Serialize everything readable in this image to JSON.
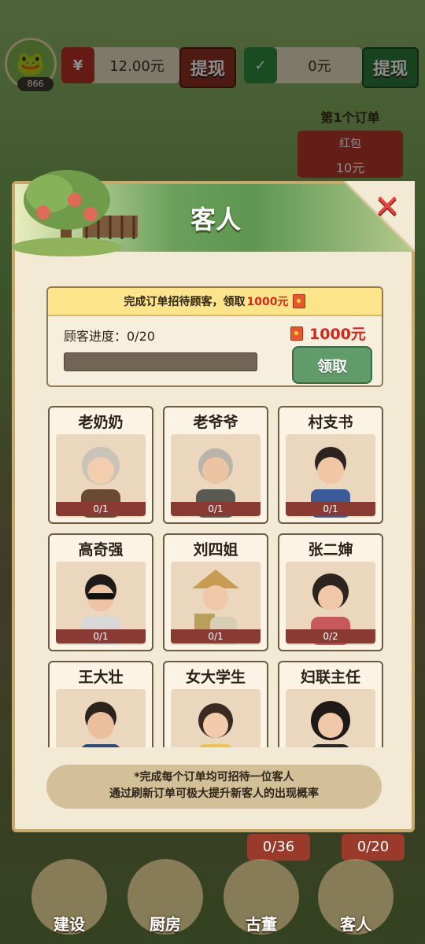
{
  "topbar": {
    "level": "866",
    "cash_red": "12.00元",
    "withdraw_label": "提现",
    "cash_green": "0元",
    "withdraw_label_2": "提现"
  },
  "order": {
    "title": "第1个订单",
    "reward_label": "红包",
    "reward_amount": "10元"
  },
  "modal": {
    "title": "客人",
    "close": "✕",
    "progress": {
      "banner_prefix": "完成订单招待顾客，领取",
      "banner_amount": "1000元",
      "label": "顾客进度：0/20",
      "current": 0,
      "total": 20,
      "reward": "1000元",
      "claim_label": "领取"
    },
    "guests": [
      {
        "name": "老奶奶",
        "count": "0/1"
      },
      {
        "name": "老爷爷",
        "count": "0/1"
      },
      {
        "name": "村支书",
        "count": "0/1"
      },
      {
        "name": "高奇强",
        "count": "0/1"
      },
      {
        "name": "刘四姐",
        "count": "0/1"
      },
      {
        "name": "张二婶",
        "count": "0/2"
      },
      {
        "name": "王大壮",
        "count": ""
      },
      {
        "name": "女大学生",
        "count": ""
      },
      {
        "name": "妇联主任",
        "count": ""
      }
    ],
    "note_line1": "*完成每个订单均可招待一位客人",
    "note_line2": "通过刷新订单可极大提升新客人的出现概率"
  },
  "nav": {
    "build": "建设",
    "kitchen": "厨房",
    "antique": "古董",
    "antique_badge": "0/36",
    "guests": "客人",
    "guests_badge": "0/20"
  },
  "colors": {
    "accent_green": "#5f9c6a",
    "accent_red": "#d6261c",
    "panel": "#f3ead6"
  }
}
